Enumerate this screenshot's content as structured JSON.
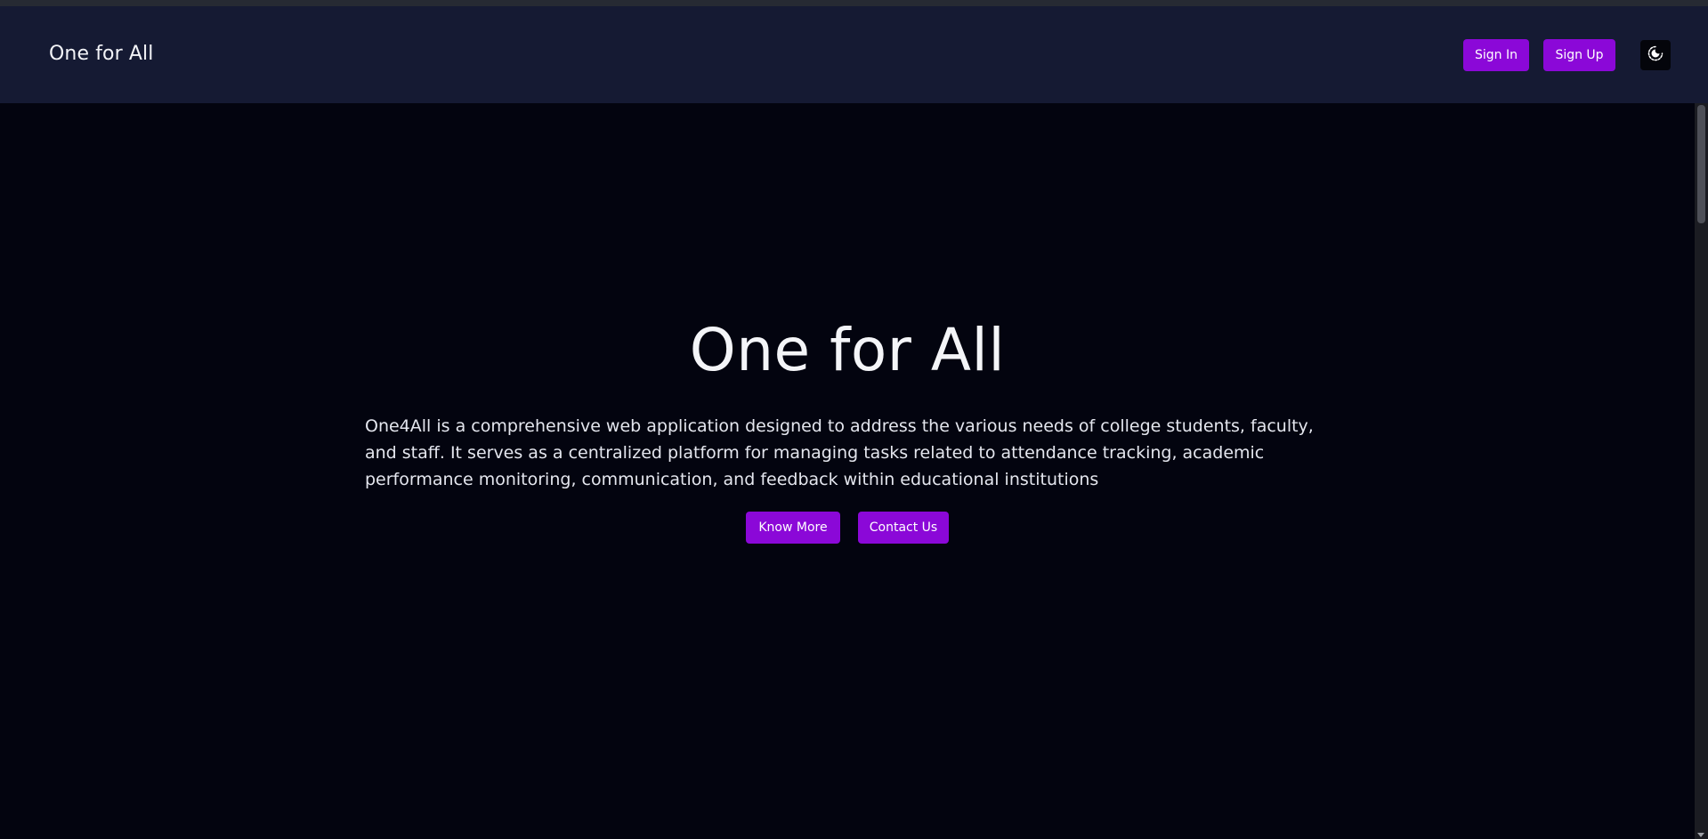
{
  "header": {
    "brand": "One for All",
    "sign_in_label": "Sign In",
    "sign_up_label": "Sign Up",
    "theme_icon": "moon-sun-toggle-icon"
  },
  "hero": {
    "title": "One for All",
    "description": "One4All is a comprehensive web application designed to address the various needs of college students, faculty, and staff. It serves as a centralized platform for managing tasks related to attendance tracking, academic performance monitoring, communication, and feedback within educational institutions",
    "know_more_label": "Know More",
    "contact_us_label": "Contact Us"
  },
  "colors": {
    "accent": "#8b08d8",
    "navbar_bg": "#151a33",
    "page_bg": "#03040f"
  }
}
